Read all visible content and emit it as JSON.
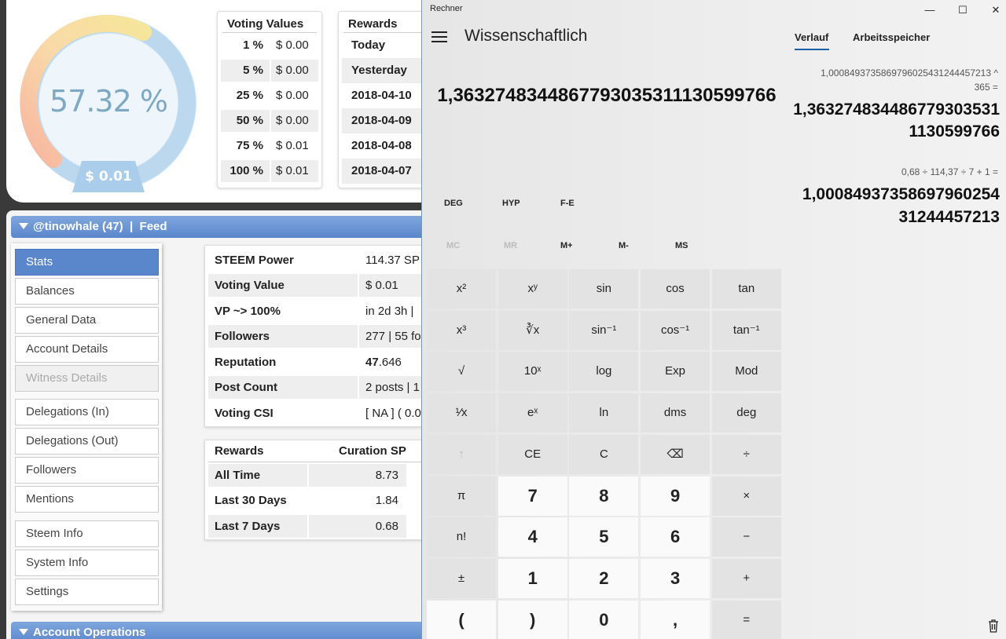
{
  "gauge": {
    "percent_text": "57.32 %",
    "percent_value": 57.32,
    "value_text": "$ 0.01"
  },
  "voting_values": {
    "title": "Voting Values",
    "rows": [
      {
        "pct": "1 %",
        "val": "$ 0.00"
      },
      {
        "pct": "5 %",
        "val": "$ 0.00"
      },
      {
        "pct": "25 %",
        "val": "$ 0.00"
      },
      {
        "pct": "50 %",
        "val": "$ 0.00"
      },
      {
        "pct": "75 %",
        "val": "$ 0.01"
      },
      {
        "pct": "100 %",
        "val": "$ 0.01"
      }
    ]
  },
  "rewards_top": {
    "title": "Rewards",
    "rows": [
      "Today",
      "Yesterday",
      "2018-04-10",
      "2018-04-09",
      "2018-04-08",
      "2018-04-07"
    ]
  },
  "feed_bar": {
    "user": "@tinowhale (47)",
    "sep": "|",
    "feed": "Feed"
  },
  "sidebar": {
    "items": [
      "Stats",
      "Balances",
      "General Data",
      "Account Details",
      "Witness Details",
      "Delegations (In)",
      "Delegations (Out)",
      "Followers",
      "Mentions",
      "Steem Info",
      "System Info",
      "Settings"
    ]
  },
  "stats": {
    "rows": [
      {
        "label": "STEEM Power",
        "value": "114.37 SP"
      },
      {
        "label": "Voting Value",
        "value": "$ 0.01"
      },
      {
        "label": "VP ~> 100%",
        "value": "in 2d 3h |"
      },
      {
        "label": "Followers",
        "value": "277 | 55 fo"
      },
      {
        "label": "Reputation",
        "value_bold": "47",
        "value_rest": ".646"
      },
      {
        "label": "Post Count",
        "value": "2 posts | 1"
      },
      {
        "label": "Voting CSI",
        "value": "[ NA ] ( 0.0"
      }
    ]
  },
  "rewards_box": {
    "col1": "Rewards",
    "col2": "Curation SP",
    "rows": [
      {
        "label": "All Time",
        "value": "8.73"
      },
      {
        "label": "Last 30 Days",
        "value": "1.84"
      },
      {
        "label": "Last 7 Days",
        "value": "0.68"
      }
    ]
  },
  "account_ops": {
    "label": "Account Operations"
  },
  "calc": {
    "app_title": "Rechner",
    "mode": "Wissenschaftlich",
    "display": "1,3632748344867793035311130599766",
    "window_buttons": {
      "min": "—",
      "max": "☐",
      "close": "✕"
    },
    "mode_buttons": [
      "DEG",
      "HYP",
      "F-E"
    ],
    "memory_buttons": [
      "MC",
      "MR",
      "M+",
      "M-",
      "MS"
    ],
    "keys": [
      [
        "x²",
        "xʸ",
        "sin",
        "cos",
        "tan"
      ],
      [
        "x³",
        "∛x",
        "sin⁻¹",
        "cos⁻¹",
        "tan⁻¹"
      ],
      [
        "√",
        "10ˣ",
        "log",
        "Exp",
        "Mod"
      ],
      [
        "¹⁄x",
        "eˣ",
        "ln",
        "dms",
        "deg"
      ],
      [
        "↑",
        "CE",
        "C",
        "⌫",
        "÷"
      ],
      [
        "π",
        "7",
        "8",
        "9",
        "×"
      ],
      [
        "n!",
        "4",
        "5",
        "6",
        "−"
      ],
      [
        "±",
        "1",
        "2",
        "3",
        "+"
      ],
      [
        "(",
        ")",
        "0",
        ",",
        "="
      ]
    ],
    "tabs": [
      "Verlauf",
      "Arbeitsspeicher"
    ],
    "history": [
      {
        "expr": "1,0008493735869796025431244457213  ^",
        "expr2": "365 =",
        "result_l1": "1,363274834486779303531",
        "result_l2": "1130599766"
      },
      {
        "expr": "0,68  ÷  114,37  ÷  7  +  1 =",
        "result_l1": "1,00084937358697960254",
        "result_l2": "31244457213"
      }
    ]
  }
}
